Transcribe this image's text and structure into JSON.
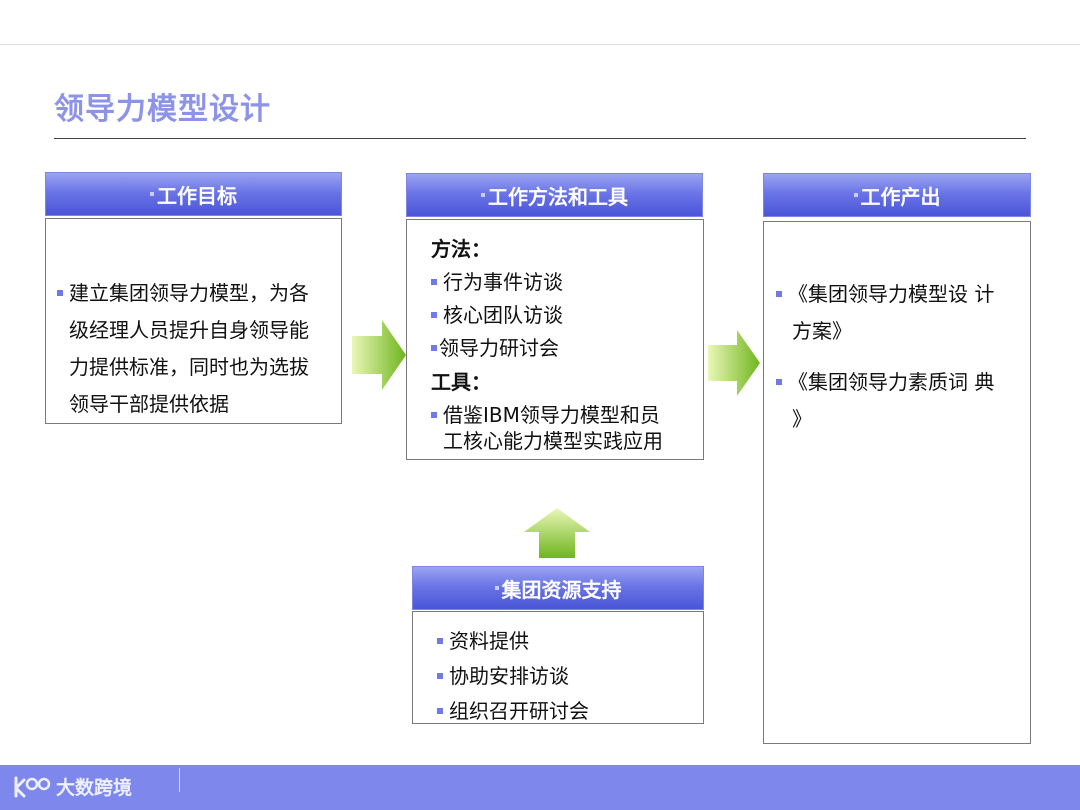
{
  "slide": {
    "title": "领导力模型设计"
  },
  "goal": {
    "header": "工作目标",
    "text_line1": "建立集团领导力模型，为各",
    "text_rest": [
      "级经理人员提升自身领导能",
      "力提供标准，同时也为选拔",
      "领导干部提供依据"
    ]
  },
  "methods": {
    "header": "工作方法和工具",
    "method_label": "方法：",
    "method_items": [
      "行为事件访谈",
      "核心团队访谈",
      "领导力研讨会"
    ],
    "tool_label": "工具：",
    "tool_line1": "借鉴IBM领导力模型和员",
    "tool_line2": "工核心能力模型实践应用"
  },
  "output": {
    "header": "工作产出",
    "item1_line1": "《集团领导力模型设 计",
    "item1_line2": "方案》",
    "item2_line1": "《集团领导力素质词 典",
    "item2_line2": "》"
  },
  "support": {
    "header": "集团资源支持",
    "items": [
      "资料提供",
      "协助安排访谈",
      "组织召开研讨会"
    ]
  },
  "footer": {
    "logo_text": "大数跨境"
  },
  "colors": {
    "title": "#8c93e8",
    "header_gradient_top": "#9ba3f2",
    "header_gradient_bottom": "#4a55d8",
    "arrow_green_light": "#e6f5b0",
    "arrow_green_dark": "#6fb51e",
    "bullet": "#6f7ae8",
    "footer_bar": "#7d87ec"
  },
  "icons": [
    "arrow-right-icon",
    "arrow-up-icon",
    "logo-icon"
  ]
}
